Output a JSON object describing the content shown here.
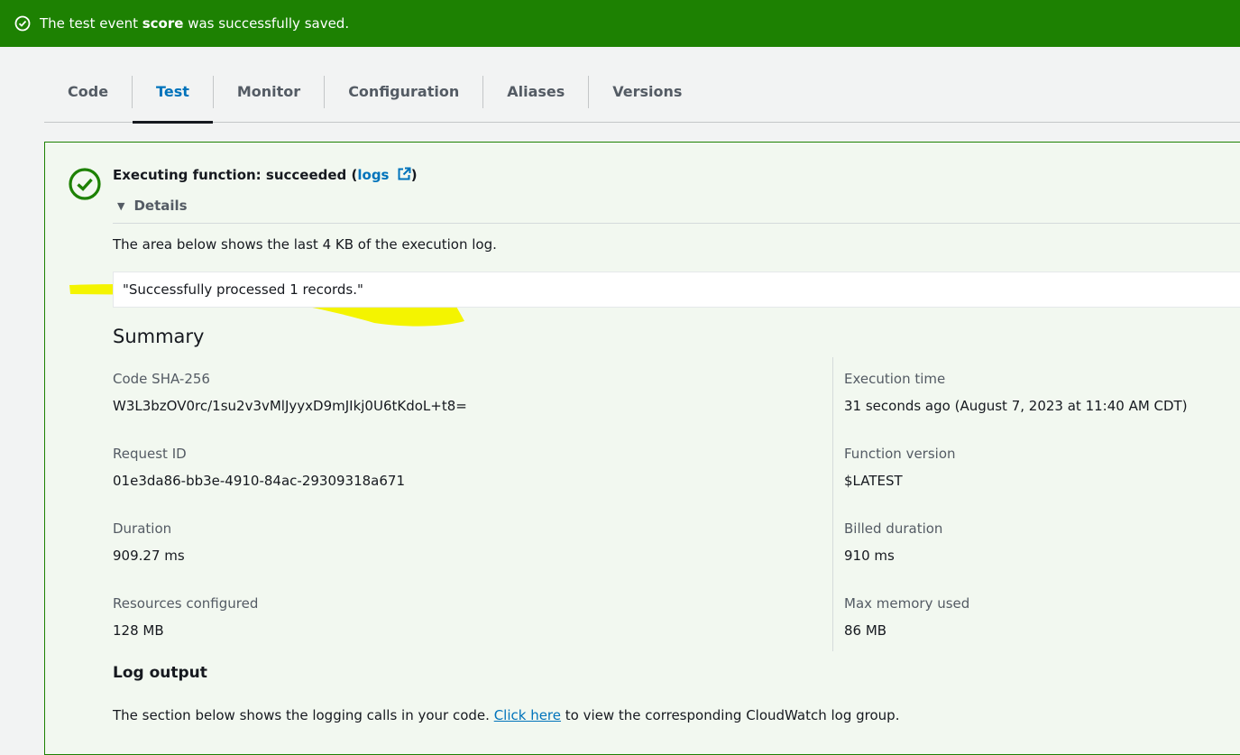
{
  "flash": {
    "prefix": "The test event ",
    "event_name": "score",
    "suffix": " was successfully saved.",
    "icon": "check-circle-icon"
  },
  "tabs": [
    {
      "label": "Code"
    },
    {
      "label": "Test",
      "active": true
    },
    {
      "label": "Monitor"
    },
    {
      "label": "Configuration"
    },
    {
      "label": "Aliases"
    },
    {
      "label": "Versions"
    }
  ],
  "result": {
    "status_prefix": "Executing function: succeeded (",
    "logs_link": "logs",
    "status_suffix": ")",
    "details_label": "Details",
    "area_text": "The area below shows the last 4 KB of the execution log.",
    "log_line": "\"Successfully processed 1 records.\""
  },
  "summary": {
    "title": "Summary",
    "left": [
      {
        "label": "Code SHA-256",
        "value": "W3L3bzOV0rc/1su2v3vMlJyyxD9mJIkj0U6tKdoL+t8="
      },
      {
        "label": "Request ID",
        "value": "01e3da86-bb3e-4910-84ac-29309318a671"
      },
      {
        "label": "Duration",
        "value": "909.27 ms"
      },
      {
        "label": "Resources configured",
        "value": "128 MB"
      }
    ],
    "right": [
      {
        "label": "Execution time",
        "value": "31 seconds ago (August 7, 2023 at 11:40 AM CDT)"
      },
      {
        "label": "Function version",
        "value": "$LATEST"
      },
      {
        "label": "Billed duration",
        "value": "910 ms"
      },
      {
        "label": "Max memory used",
        "value": "86 MB"
      }
    ]
  },
  "log_output": {
    "title": "Log output",
    "text_before": "The section below shows the logging calls in your code. ",
    "link": "Click here",
    "text_after": " to view the corresponding CloudWatch log group."
  },
  "colors": {
    "success_green": "#1d8102",
    "link_blue": "#0073bb",
    "highlight_yellow": "#f4f400"
  }
}
